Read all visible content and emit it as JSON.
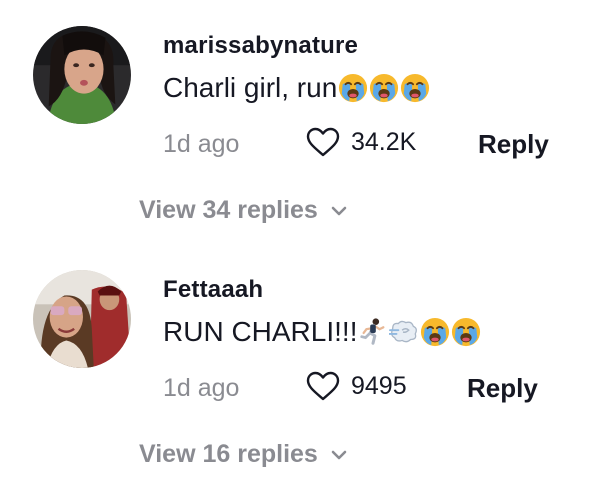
{
  "comments": [
    {
      "username": "marissabynature",
      "text": "Charli girl, run",
      "emojis": [
        "loudly-crying-face-icon",
        "loudly-crying-face-icon",
        "loudly-crying-face-icon"
      ],
      "time": "1d ago",
      "likes": "34.2K",
      "reply_label": "Reply",
      "view_replies": "View 34 replies"
    },
    {
      "username": "Fettaaah",
      "text": "RUN CHARLI!!!",
      "emojis": [
        "person-running-icon",
        "dashing-away-icon",
        "loudly-crying-face-icon",
        "loudly-crying-face-icon"
      ],
      "time": "1d ago",
      "likes": "9495",
      "reply_label": "Reply",
      "view_replies": "View 16 replies"
    }
  ],
  "colors": {
    "primary_text": "#161823",
    "secondary_text": "#8a8b91",
    "background": "#ffffff"
  }
}
